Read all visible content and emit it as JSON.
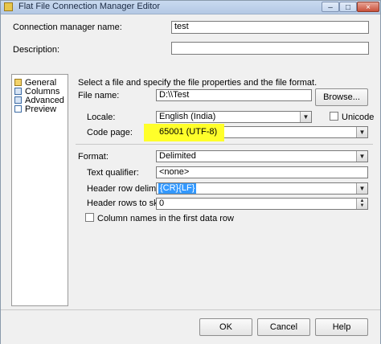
{
  "window": {
    "title": "Flat File Connection Manager Editor",
    "minimize": "–",
    "maximize": "□",
    "close": "×"
  },
  "connection_manager_name": {
    "label": "Connection manager name:",
    "value": "test"
  },
  "description": {
    "label": "Description:",
    "value": ""
  },
  "nav": {
    "items": [
      {
        "label": "General",
        "icon": "general-icon"
      },
      {
        "label": "Columns",
        "icon": "columns-icon"
      },
      {
        "label": "Advanced",
        "icon": "advanced-icon"
      },
      {
        "label": "Preview",
        "icon": "preview-icon"
      }
    ],
    "selected": "General"
  },
  "general": {
    "instruction": "Select a file and specify the file properties and the file format.",
    "file_name": {
      "label": "File name:",
      "value": "D:\\\\Test"
    },
    "browse_button": "Browse...",
    "locale": {
      "label": "Locale:",
      "value": "English (India)"
    },
    "unicode": {
      "label": "Unicode",
      "checked": false
    },
    "code_page": {
      "label": "Code page:",
      "value": "65001 (UTF-8)"
    },
    "format": {
      "label": "Format:",
      "value": "Delimited"
    },
    "text_qualifier": {
      "label": "Text qualifier:",
      "value": "<none>"
    },
    "header_row_delimiter": {
      "label": "Header row delimiter:",
      "value": "{CR}{LF}"
    },
    "header_rows_to_skip": {
      "label": "Header rows to skip:",
      "value": "0"
    },
    "column_names_first_row": {
      "label": "Column names in the first data row",
      "checked": false
    }
  },
  "buttons": {
    "ok": "OK",
    "cancel": "Cancel",
    "help": "Help"
  },
  "colors": {
    "highlight": "#ffff2a",
    "selection": "#3399ff"
  }
}
